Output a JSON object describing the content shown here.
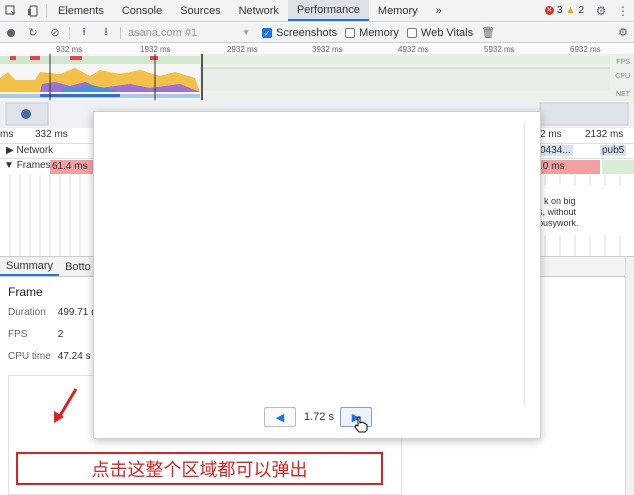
{
  "tabbar": {
    "tabs": [
      "Elements",
      "Console",
      "Sources",
      "Network",
      "Performance",
      "Memory"
    ],
    "active_tab": "Performance",
    "more": "»",
    "errors_count": "3",
    "warnings_count": "2"
  },
  "toolbar": {
    "url": "asana.com #1",
    "screenshots_label": "Screenshots",
    "memory_label": "Memory",
    "web_vitals_label": "Web Vitals"
  },
  "overview": {
    "ruler": [
      "932 ms",
      "1932 ms",
      "2932 ms",
      "3932 ms",
      "4932 ms",
      "5932 ms",
      "6932 ms"
    ],
    "labels": [
      "FPS",
      "CPU",
      "NET"
    ]
  },
  "timeline": {
    "left_ms_a": "ms",
    "left_ms_b": "332 ms",
    "right_ms_a": "2 ms",
    "right_ms_b": "2132 ms",
    "network_label": "Network",
    "frames_label": "Frames",
    "frames_value": "61.4 ms",
    "right_network_a": "0434...",
    "right_network_b": "pub5",
    "right_frames": ".0 ms",
    "hint_lines": [
      "k on big",
      "s, without",
      "busywork."
    ]
  },
  "bottom": {
    "tabs": [
      "Summary",
      "Botto"
    ],
    "section_title": "Frame",
    "duration_label": "Duration",
    "duration_value": "499.71 m",
    "fps_label": "FPS",
    "fps_value": "2",
    "cpu_label": "CPU time",
    "cpu_value": "47.24 s"
  },
  "modal": {
    "time": "1.72 s"
  },
  "annotation": {
    "text": "点击这整个区域都可以弹出"
  },
  "colors": {
    "accent": "#1a73e8",
    "frame_red": "#f2a0a0",
    "annotation_red": "#e02020"
  }
}
